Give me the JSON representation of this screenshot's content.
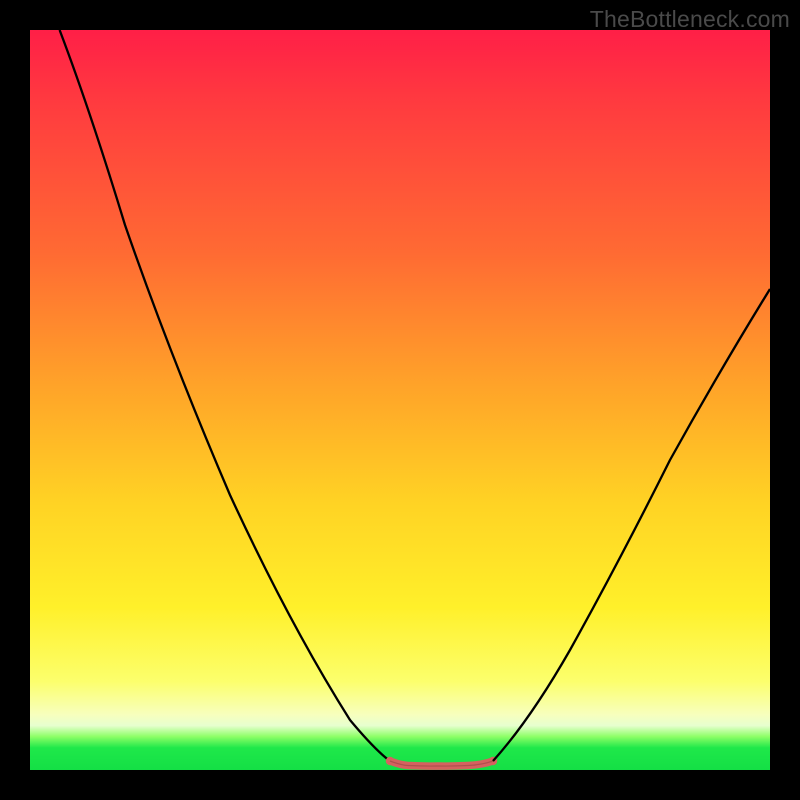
{
  "watermark": "TheBottleneck.com",
  "chart_data": {
    "type": "line",
    "title": "",
    "xlabel": "",
    "ylabel": "",
    "xlim": [
      0,
      100
    ],
    "ylim": [
      0,
      100
    ],
    "grid": false,
    "legend": false,
    "series": [
      {
        "name": "left-curve",
        "x": [
          4,
          10,
          18,
          26,
          34,
          42,
          47.5,
          49.5
        ],
        "values": [
          100,
          86,
          68,
          49,
          30,
          12,
          3,
          0.8
        ]
      },
      {
        "name": "valley-floor",
        "x": [
          49.5,
          51,
          53,
          55,
          57,
          59,
          61,
          62.5
        ],
        "values": [
          0.8,
          0.5,
          0.4,
          0.35,
          0.4,
          0.5,
          0.7,
          1.0
        ]
      },
      {
        "name": "right-curve",
        "x": [
          62.5,
          68,
          76,
          84,
          92,
          100
        ],
        "values": [
          1.0,
          8,
          22,
          38,
          52,
          65
        ]
      }
    ],
    "annotations": [
      {
        "name": "valley-marker",
        "x_range": [
          49.5,
          62.5
        ],
        "y": 0.8,
        "color": "#d4625f"
      }
    ]
  },
  "colors": {
    "curve": "#000000",
    "valley_marker": "#d4625f",
    "background": "#000000"
  }
}
